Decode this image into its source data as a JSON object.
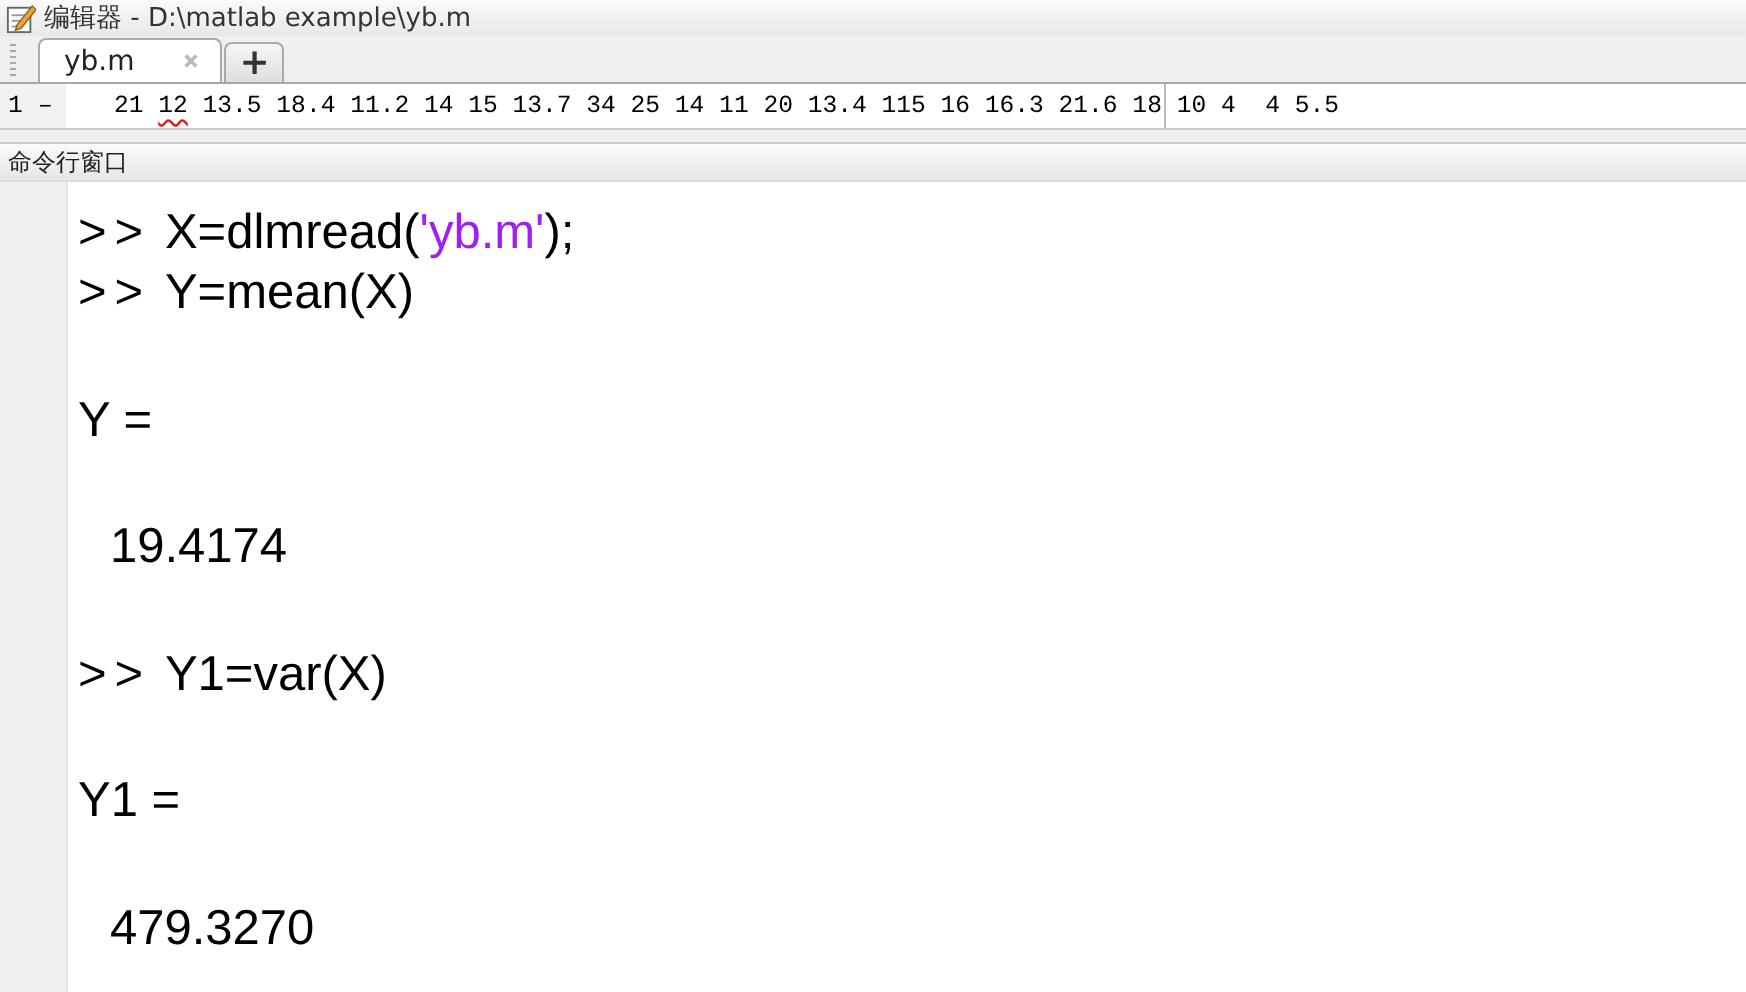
{
  "window": {
    "title": "编辑器 - D:\\matlab example\\yb.m"
  },
  "tabs": [
    {
      "label": "yb.m",
      "selected": true
    }
  ],
  "new_tab_button": "+",
  "editor": {
    "lines": [
      {
        "number": "1",
        "marker": "–",
        "segments": [
          {
            "text": "21 ",
            "warning": false
          },
          {
            "text": "12",
            "warning": true
          },
          {
            "text": " 13.5 18.4 11.2 14 15 13.7 34 25 14 11 20 13.4 115 16 16.3 21.6 18 10 4  4 5.5",
            "warning": false
          }
        ]
      }
    ]
  },
  "command_window": {
    "title": "命令行窗口",
    "lines": [
      {
        "kind": "command",
        "prompt": ">>",
        "parts": [
          {
            "kind": "code",
            "text": "X=dlmread("
          },
          {
            "kind": "string",
            "text": "'yb.m'"
          },
          {
            "kind": "code",
            "text": ");"
          }
        ]
      },
      {
        "kind": "command",
        "prompt": ">>",
        "parts": [
          {
            "kind": "code",
            "text": "Y=mean(X)"
          }
        ]
      },
      {
        "kind": "blank"
      },
      {
        "kind": "output",
        "text": "Y ="
      },
      {
        "kind": "blank"
      },
      {
        "kind": "value",
        "text": "19.4174"
      },
      {
        "kind": "blank"
      },
      {
        "kind": "command",
        "prompt": ">>",
        "parts": [
          {
            "kind": "code",
            "text": "Y1=var(X)"
          }
        ]
      },
      {
        "kind": "blank"
      },
      {
        "kind": "output",
        "text": "Y1 ="
      },
      {
        "kind": "blank"
      },
      {
        "kind": "value",
        "text": "479.3270"
      }
    ]
  }
}
